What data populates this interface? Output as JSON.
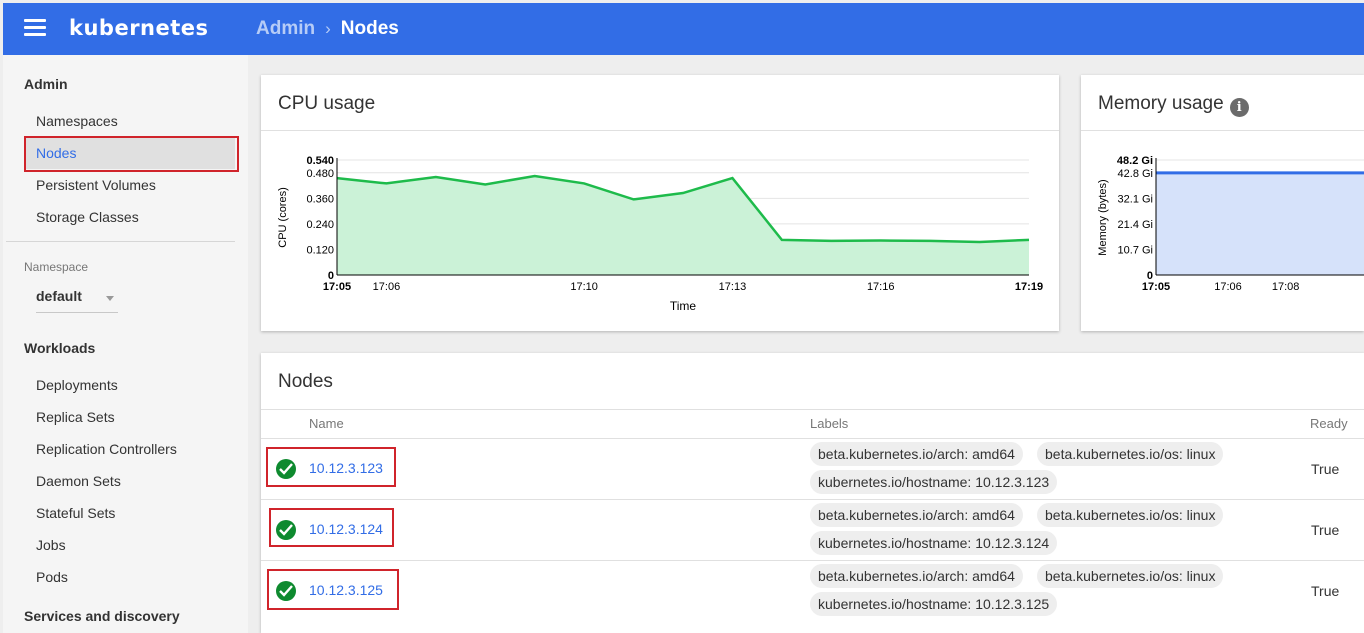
{
  "header": {
    "brand": "kubernetes",
    "breadcrumb_parent": "Admin",
    "breadcrumb_sep": "›",
    "breadcrumb_current": "Nodes"
  },
  "sidebar": {
    "admin_heading": "Admin",
    "admin_items": [
      {
        "label": "Namespaces"
      },
      {
        "label": "Nodes",
        "active": true
      },
      {
        "label": "Persistent Volumes"
      },
      {
        "label": "Storage Classes"
      }
    ],
    "namespace_label": "Namespace",
    "namespace_value": "default",
    "workloads_heading": "Workloads",
    "workload_items": [
      {
        "label": "Deployments"
      },
      {
        "label": "Replica Sets"
      },
      {
        "label": "Replication Controllers"
      },
      {
        "label": "Daemon Sets"
      },
      {
        "label": "Stateful Sets"
      },
      {
        "label": "Jobs"
      },
      {
        "label": "Pods"
      }
    ],
    "services_heading": "Services and discovery"
  },
  "cpu_card": {
    "title": "CPU usage",
    "chart_data": {
      "type": "area",
      "ylabel": "CPU (cores)",
      "xlabel": "Time",
      "y_ticks": [
        "0",
        "0.120",
        "0.240",
        "0.360",
        "0.480",
        "0.540"
      ],
      "x_ticks": [
        "17:05",
        "17:06",
        "17:10",
        "17:13",
        "17:16",
        "17:19"
      ],
      "ylim": [
        0,
        0.54
      ],
      "x_minutes": [
        "17:05",
        "17:06",
        "17:07",
        "17:08",
        "17:09",
        "17:10",
        "17:11",
        "17:12",
        "17:13",
        "17:14",
        "17:15",
        "17:16",
        "17:17",
        "17:18",
        "17:19"
      ],
      "values": [
        0.455,
        0.43,
        0.46,
        0.425,
        0.465,
        0.43,
        0.355,
        0.385,
        0.455,
        0.165,
        0.16,
        0.162,
        0.16,
        0.155,
        0.165
      ],
      "color": "#1ebb4b",
      "fill": "#cbf2d7"
    }
  },
  "memory_card": {
    "title": "Memory usage",
    "info_glyph": "i",
    "chart_data": {
      "type": "area",
      "ylabel": "Memory (bytes)",
      "y_ticks": [
        "0",
        "10.7 Gi",
        "21.4 Gi",
        "32.1 Gi",
        "42.8 Gi",
        "48.2 Gi"
      ],
      "x_ticks": [
        "17:05",
        "17:06",
        "17:08"
      ],
      "value_label": "42.8 Gi",
      "color": "#326de6",
      "fill": "#d6e2fa"
    }
  },
  "nodes_card": {
    "title": "Nodes",
    "columns": {
      "name": "Name",
      "labels": "Labels",
      "ready": "Ready"
    },
    "rows": [
      {
        "name": "10.12.3.123",
        "labels": [
          "beta.kubernetes.io/arch: amd64",
          "beta.kubernetes.io/os: linux",
          "kubernetes.io/hostname: 10.12.3.123"
        ],
        "ready": "True"
      },
      {
        "name": "10.12.3.124",
        "labels": [
          "beta.kubernetes.io/arch: amd64",
          "beta.kubernetes.io/os: linux",
          "kubernetes.io/hostname: 10.12.3.124"
        ],
        "ready": "True"
      },
      {
        "name": "10.12.3.125",
        "labels": [
          "beta.kubernetes.io/arch: amd64",
          "beta.kubernetes.io/os: linux",
          "kubernetes.io/hostname: 10.12.3.125"
        ],
        "ready": "True"
      }
    ]
  },
  "colors": {
    "accent": "#326de6",
    "highlight": "#d0242b",
    "ok": "#0e8a2f"
  }
}
